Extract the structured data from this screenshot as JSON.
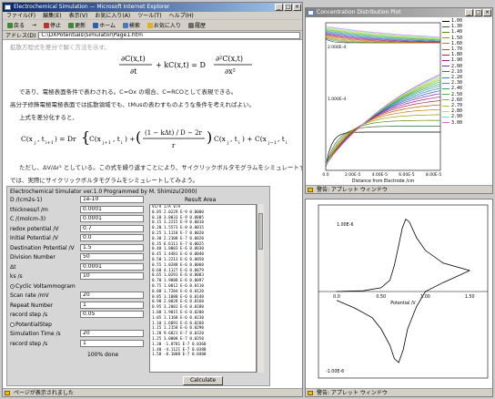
{
  "browser": {
    "title": "Electrochemical Simulation — Microsoft Internet Explorer",
    "menu": [
      "ファイル(F)",
      "編集(E)",
      "表示(V)",
      "お気に入り(A)",
      "ツール(T)",
      "ヘルプ(H)"
    ],
    "toolbar": [
      "戻る",
      "→",
      "停止",
      "更新",
      "ホーム",
      "検索",
      "お気に入り",
      "履歴"
    ],
    "address_label": "アドレス(D)",
    "address_value": "C:\\DXPotentials\\Simulator\\Page1.htm",
    "status": "ページが表示されました"
  },
  "doc": {
    "intro": "拡散方程式を差分で解く方法を示す。",
    "p1": "であり、電極表面条件で表わされる。C=Ox の場合、C=RCOとして表現できる。",
    "p2": "高分子修飾電極電極表面では拡散領域でも、tMusの表わすものような条件を考えればよい。",
    "p3": "上式を差分化すると、",
    "p4": "ただし、ΔV/Δr² としている。この式を繰り返すことにより、サイクリックボルタモグラムをシミュレートすることができる。",
    "p5": "では、実際にサイクリックボルタモグラムをシミュレートしてみよう。"
  },
  "applet": {
    "header": "Electrochemical Simulator ver.1.0  Programmed by M. Shimizu(2000)",
    "fields": [
      {
        "label": "D /(cm2s-1)",
        "value": "1e-10"
      },
      {
        "label": "thickness/l /m",
        "value": "0.0001"
      },
      {
        "label": "C /(molcm-3)",
        "value": "0.0001"
      },
      {
        "label": "redox potential /V",
        "value": "0.7"
      },
      {
        "label": "Initial Potential /V",
        "value": "0.0"
      },
      {
        "label": "Destination Potential /V",
        "value": "1.5"
      },
      {
        "label": "Division Number",
        "value": "50"
      },
      {
        "label": "Δt",
        "value": "0.0001"
      },
      {
        "label": "ks /s",
        "value": "10"
      }
    ],
    "mode_cv": "Cyclic Voltammogram",
    "fields2": [
      {
        "label": "Scan rate /mV",
        "value": "20"
      },
      {
        "label": "Repeat Number",
        "value": "1"
      },
      {
        "label": "record step /s",
        "value": "0.05"
      }
    ],
    "mode_step": "PotentialStep",
    "fields3": [
      {
        "label": "Simulation Time /s",
        "value": "20"
      },
      {
        "label": "record step /s",
        "value": "1"
      }
    ],
    "done_text": "100% done",
    "calc_button": "Calculate",
    "result_label": "Result Area",
    "result_header": "Vs/V   I/A   V/A",
    "results": [
      "0.05  2.0229 E-9   0.0000",
      "0.10  3.0033 E-9   0.0005",
      "0.15  3.2215 E-9   0.0010",
      "0.20  1.5573 E-8   0.0015",
      "0.25  1.1118 E-7   0.0020",
      "0.30  2.2108 E-7   0.0020",
      "0.35  6.6111 E-7   0.0025",
      "0.40  1.0003 E-6   0.0030",
      "0.45  1.4481 E-6   0.0040",
      "0.50  1.2213 E-6   0.0050",
      "0.55  1.0288 E-6   0.0060",
      "0.60  4.1127 E-6   0.0079",
      "0.65  1.0291 E-6   0.0083",
      "0.70  1.9088 E-6   0.0097",
      "0.75  1.0012 E-6   0.0110",
      "0.80  1.7284 E-6   0.0120",
      "0.85  1.1088 E-6   0.0140",
      "0.90  2.0028 E-6   0.0160",
      "0.95  3.2001 E-6   0.0180",
      "1.00  1.9015 E-6   0.0200",
      "1.05  1.1168 E-6   0.0230",
      "1.10  1.6891 E-6   0.0260",
      "1.15  1.2158 E-6   0.0290",
      "1.20  9.6021 E-7   0.0320",
      "1.25  3.0008 E-7   0.0350",
      "1.30  -1.0781 E-7  0.0360",
      "1.40  -4.1121 E-7  0.0380",
      "1.50  -8.1008 E-7  0.0400"
    ]
  },
  "conc_window": {
    "title": "Concentration Distribution Plot",
    "xlabel": "Distance from Electrode /cm",
    "y_top_label": "2.000E-4",
    "y_mid_label": "1.000E-4",
    "x_ticks": [
      "0.0",
      "2.00E-5",
      "4.00E-5",
      "6.00E-5",
      "8.00E-5"
    ],
    "legend": [
      "1.00",
      "1.30",
      "1.40",
      "1.50",
      "1.60",
      "1.70",
      "1.80",
      "1.90",
      "2.00",
      "2.10",
      "2.20",
      "2.30",
      "2.40",
      "2.50",
      "2.60",
      "2.70",
      "2.80",
      "2.90",
      "3.00"
    ],
    "legend_colors": [
      "#000000",
      "#2e6b2e",
      "#5a8f00",
      "#9b9b00",
      "#c08000",
      "#c05000",
      "#b02040",
      "#a01890",
      "#7030b0",
      "#4050c0",
      "#3080c0",
      "#30a0a0",
      "#30a070",
      "#50b050",
      "#80c030",
      "#a0d040",
      "#c0e060",
      "#60e0e0",
      "#e060e0"
    ],
    "status": "警告: アプレット ウィンドウ"
  },
  "cv_window": {
    "title": "Cyclic Voltammogram",
    "xlabel": "Potential /V",
    "y_top_label": "1.00E-6",
    "y_bottom_label": "-1.00E-6",
    "x_ticks": [
      "0.0",
      "0.50",
      "1.00",
      "1.50"
    ],
    "status": "警告: アプレット ウィンドウ"
  },
  "chart_data": [
    {
      "type": "line",
      "title": "",
      "xlabel": "Distance from Electrode /cm",
      "ylabel": "",
      "xlim": [
        0,
        0.0001
      ],
      "ylim": [
        0,
        0.0002
      ],
      "series_count": 19
    },
    {
      "type": "line",
      "title": "",
      "xlabel": "Potential /V",
      "ylabel": "",
      "xlim": [
        0,
        1.6
      ],
      "ylim": [
        -1.5e-06,
        1.5e-06
      ],
      "forward": [
        [
          0.0,
          0.0
        ],
        [
          0.3,
          0.01
        ],
        [
          0.5,
          0.05
        ],
        [
          0.6,
          0.15
        ],
        [
          0.65,
          0.35
        ],
        [
          0.7,
          0.62
        ],
        [
          0.74,
          0.85
        ],
        [
          0.78,
          0.97
        ],
        [
          0.82,
          0.93
        ],
        [
          0.9,
          0.72
        ],
        [
          1.0,
          0.55
        ],
        [
          1.2,
          0.38
        ],
        [
          1.5,
          0.28
        ]
      ],
      "reverse": [
        [
          1.5,
          0.28
        ],
        [
          1.2,
          0.12
        ],
        [
          1.0,
          0.0
        ],
        [
          0.9,
          -0.2
        ],
        [
          0.8,
          -0.5
        ],
        [
          0.75,
          -0.78
        ],
        [
          0.7,
          -0.95
        ],
        [
          0.65,
          -0.9
        ],
        [
          0.6,
          -0.72
        ],
        [
          0.5,
          -0.5
        ],
        [
          0.4,
          -0.35
        ],
        [
          0.2,
          -0.22
        ],
        [
          0.0,
          -0.12
        ]
      ],
      "y_unit_scale": "1.00E-6"
    }
  ]
}
